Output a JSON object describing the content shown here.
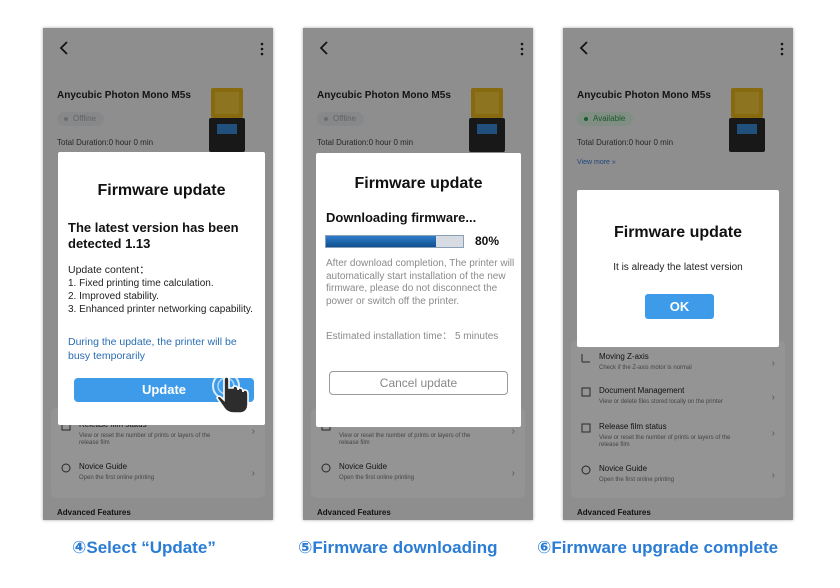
{
  "colors": {
    "accent": "#3d9bea",
    "caption": "#2a7cd4",
    "link_text": "#2a6db3",
    "available": "#2e9b4b"
  },
  "icons": {
    "back": "chevron-left-icon",
    "more": "more-vertical-icon",
    "cursor": "hand-pointer-icon"
  },
  "printer": {
    "name": "Anycubic Photon Mono M5s",
    "duration": "Total Duration:0 hour 0 min",
    "view_more": "View more »"
  },
  "panels": [
    {
      "status": "Offline",
      "dialog": {
        "title": "Firmware update",
        "detected": "The latest version has been detected 1.13",
        "content_heading": "Update content：",
        "content_items": [
          "1. Fixed printing time calculation.",
          "2. Improved stability.",
          "3. Enhanced printer networking capability."
        ],
        "note": "During the update, the printer will be busy temporarily",
        "button": "Update"
      },
      "rows": [
        {
          "title": "Release film status",
          "desc": "View or reset the number of prints or layers of the release film"
        },
        {
          "title": "Novice Guide",
          "desc": "Open the first online printing"
        }
      ],
      "advanced": "Advanced Features"
    },
    {
      "status": "Offline",
      "dialog": {
        "title": "Firmware update",
        "heading": "Downloading firmware...",
        "progress_pct": 80,
        "progress_text": "80%",
        "after_text": "After download completion, The printer will automatically start installation of the new firmware, please do not disconnect the power or switch off the printer.",
        "estimated": "Estimated installation time： 5 minutes",
        "button": "Cancel update"
      },
      "rows": [
        {
          "title": "Release film status",
          "desc": "View or reset the number of prints or layers of the release film"
        },
        {
          "title": "Novice Guide",
          "desc": "Open the first online printing"
        }
      ],
      "advanced": "Advanced Features"
    },
    {
      "status": "Available",
      "dialog": {
        "title": "Firmware update",
        "message": "It is already the latest version",
        "button": "OK"
      },
      "rows": [
        {
          "title": "Moving Z-axis",
          "desc": "Check if the Z-axis motor is normal"
        },
        {
          "title": "Document Management",
          "desc": "View or delete files stored locally on the printer"
        },
        {
          "title": "Release film status",
          "desc": "View or reset the number of prints or layers of the release film"
        },
        {
          "title": "Novice Guide",
          "desc": "Open the first online printing"
        }
      ],
      "advanced": "Advanced Features"
    }
  ],
  "captions": [
    "④Select “Update”",
    "⑤Firmware downloading",
    "⑥Firmware upgrade complete"
  ]
}
